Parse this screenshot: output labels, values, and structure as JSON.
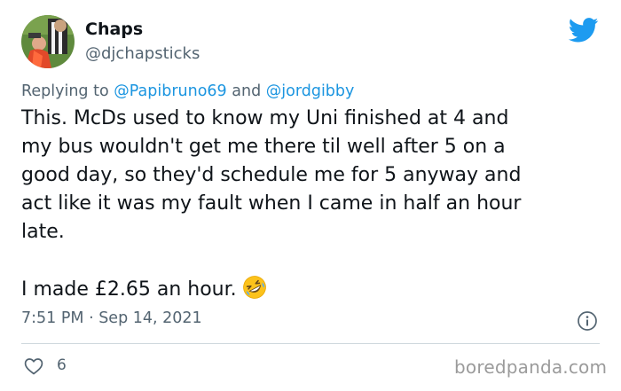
{
  "user": {
    "display_name": "Chaps",
    "handle": "@djchapsticks",
    "avatar_icon": "profile-photo"
  },
  "reply": {
    "prefix": "Replying to",
    "mention_1": "@Papibruno69",
    "conjunction": "and",
    "mention_2": "@jordgibby"
  },
  "tweet": {
    "text_paragraph_1": "This. McDs used to know my Uni finished at 4 and\nmy bus wouldn't get me there til well after 5 on a\ngood day, so they'd schedule me for 5 anyway and\nact like it was my fault when I came in half an hour\nlate.",
    "text_paragraph_2": "I made £2.65 an hour.",
    "emoji_icon": "rolling-on-floor-laughing-emoji",
    "timestamp": "7:51 PM · Sep 14, 2021"
  },
  "actions": {
    "like_count": "6",
    "like_icon": "heart-icon",
    "info_icon": "info-icon"
  },
  "branding": {
    "platform_icon": "twitter-bird-icon",
    "watermark": "boredpanda.com"
  },
  "colors": {
    "twitter_blue": "#1d9bf0",
    "mention_blue": "#1b95e0",
    "secondary_text": "#536471",
    "primary_text": "#0f1419",
    "divider": "#cfd9de"
  }
}
